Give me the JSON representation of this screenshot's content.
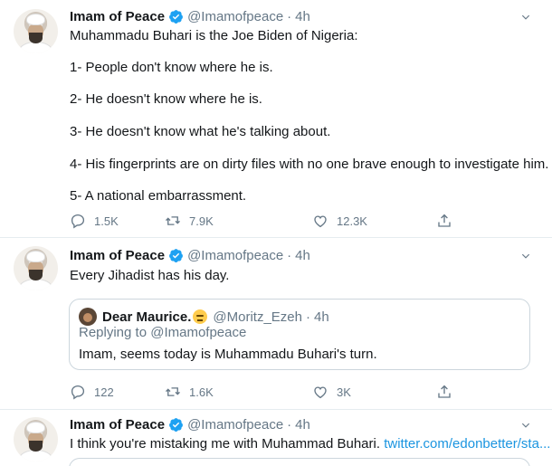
{
  "tweets": [
    {
      "name": "Imam of Peace",
      "handle": "@Imamofpeace",
      "separator": "·",
      "time": "4h",
      "lines": [
        "Muhammadu Buhari is the Joe Biden of Nigeria:",
        "1- People don't know where he is.",
        "2- He doesn't know where he is.",
        "3- He doesn't know what he's talking about.",
        "4- His fingerprints are on dirty files with no one brave enough to investigate him.",
        "5- A national embarrassment."
      ],
      "replies": "1.5K",
      "retweets": "7.9K",
      "likes": "12.3K"
    },
    {
      "name": "Imam of Peace",
      "handle": "@Imamofpeace",
      "separator": "·",
      "time": "4h",
      "text": "Every Jihadist has his day.",
      "quote": {
        "name": "Dear Maurice.",
        "handle": "@Moritz_Ezeh",
        "separator": "·",
        "time": "4h",
        "replying_to": "Replying to @Imamofpeace",
        "text": "Imam, seems today is Muhammadu Buhari's turn."
      },
      "replies": "122",
      "retweets": "1.6K",
      "likes": "3K"
    },
    {
      "name": "Imam of Peace",
      "handle": "@Imamofpeace",
      "separator": "·",
      "time": "4h",
      "text": "I think you're mistaking me with Muhammad Buhari.",
      "link": "twitter.com/edonbetter/sta..."
    }
  ],
  "icons": {
    "reply": "reply-icon",
    "retweet": "retweet-icon",
    "like": "like-icon",
    "share": "share-icon",
    "verified": "verified-badge-icon",
    "caret": "chevron-down-icon"
  },
  "colors": {
    "accent": "#1da1f2",
    "link": "#1b95e0",
    "muted": "#657786",
    "divider": "#e6ecf0"
  }
}
